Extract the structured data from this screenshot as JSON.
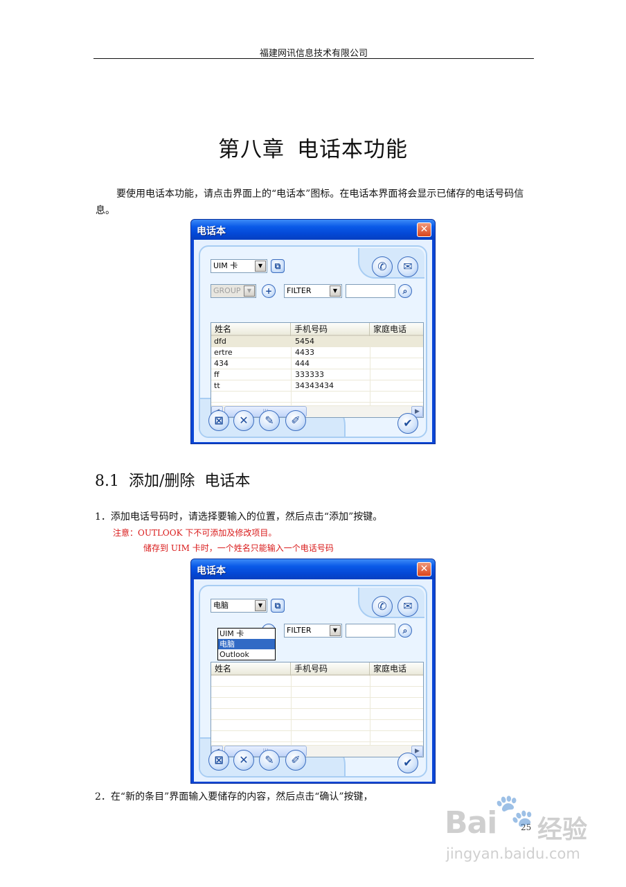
{
  "header": {
    "company": "福建网讯信息技术有限公司"
  },
  "chapter": {
    "number": "第八章",
    "title": "电话本功能"
  },
  "intro": "要使用电话本功能，请点击界面上的“电话本”图标。在电话本界面将会显示已储存的电话号码信息。",
  "section": {
    "number": "8.1",
    "title_a": "添加/删除",
    "title_b": "电话本"
  },
  "step1": "1．添加电话号码时，请选择要输入的位置，然后点击“添加”按键。",
  "note1": "注意：OUTLOOK 下不可添加及修改项目。",
  "note2": "储存到 UIM 卡时，一个姓名只能输入一个电话号码",
  "step2": "2．在“新的条目”界面输入要储存的内容，然后点击“确认”按键，",
  "page_number": "25",
  "window": {
    "title": "电话本",
    "close_glyph": "✕",
    "group_label": "GROUP",
    "filter_label": "FILTER",
    "columns": [
      "姓名",
      "手机号码",
      "家庭电话"
    ],
    "icons": {
      "copy": "copy-icon",
      "call": "phone-icon",
      "message": "envelope-icon",
      "add_group": "plus-icon",
      "search": "magnifier-icon",
      "delete_all": "delete-all-icon",
      "delete": "delete-icon",
      "add": "add-entry-icon",
      "edit": "edit-icon",
      "confirm": "checkmark-icon"
    }
  },
  "window1": {
    "storage": "UIM 卡",
    "rows": [
      {
        "name": "dfd",
        "mobile": "5454",
        "home": ""
      },
      {
        "name": "ertre",
        "mobile": "4433",
        "home": ""
      },
      {
        "name": "434",
        "mobile": "444",
        "home": ""
      },
      {
        "name": "ff",
        "mobile": "333333",
        "home": ""
      },
      {
        "name": "tt",
        "mobile": "34343434",
        "home": ""
      }
    ]
  },
  "window2": {
    "storage": "电脑",
    "options": [
      "UIM 卡",
      "电脑",
      "Outlook"
    ],
    "highlighted_option": "电脑"
  },
  "watermark": {
    "brand": "Bai",
    "brand_suffix": "经验",
    "url": "jingyan.baidu.com"
  }
}
